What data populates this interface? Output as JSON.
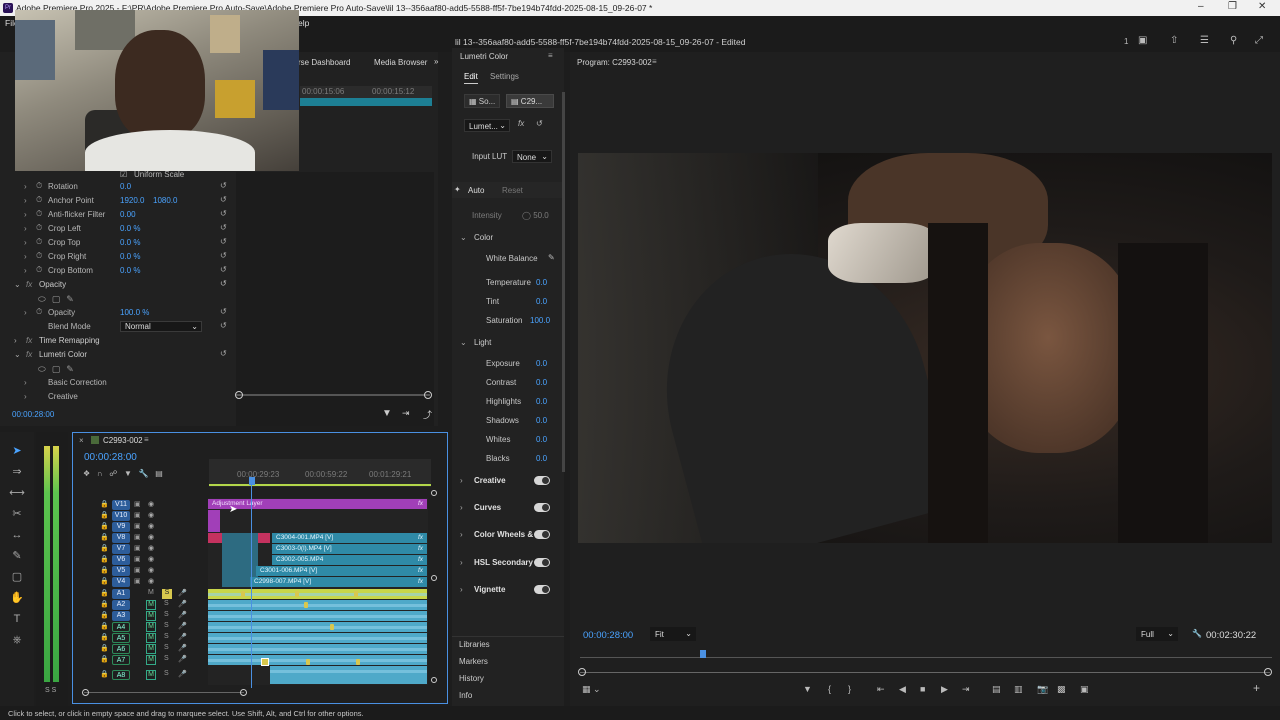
{
  "window": {
    "title": "Adobe Premiere Pro 2025 - F:\\PR\\Adobe Premiere Pro Auto-Save\\Adobe Premiere Pro Auto-Save\\lil 13--356aaf80-add5-5588-ff5f-7be194b74fdd-2025-08-15_09-26-07 *",
    "app_icon": "Pr"
  },
  "menubar": {
    "left": "File",
    "right": "elp"
  },
  "header": {
    "document": "lil 13--356aaf80-add5-5588-ff5f-7be194b74fdd-2025-08-15_09-26-07 - Edited",
    "count": "1"
  },
  "top_left_panel": {
    "tabs": [
      "rse Dashboard",
      "Media Browser"
    ],
    "ruler": [
      "00:00:15:06",
      "00:00:15:12"
    ]
  },
  "effect_controls": {
    "uniform_scale": "Uniform Scale",
    "rows": [
      {
        "label": "Rotation",
        "v1": "0.0"
      },
      {
        "label": "Anchor Point",
        "v1": "1920.0",
        "v2": "1080.0"
      },
      {
        "label": "Anti-flicker Filter",
        "v1": "0.00"
      },
      {
        "label": "Crop Left",
        "v1": "0.0 %"
      },
      {
        "label": "Crop Top",
        "v1": "0.0 %"
      },
      {
        "label": "Crop Right",
        "v1": "0.0 %"
      },
      {
        "label": "Crop Bottom",
        "v1": "0.0 %"
      }
    ],
    "opacity_section": "Opacity",
    "opacity_label": "Opacity",
    "opacity_value": "100.0 %",
    "blend_mode_label": "Blend Mode",
    "blend_mode_value": "Normal",
    "time_remapping": "Time Remapping",
    "lumetri_section": "Lumetri Color",
    "basic_correction": "Basic Correction",
    "creative": "Creative",
    "timecode": "00:00:28:00"
  },
  "lumetri_panel": {
    "title": "Lumetri Color",
    "tabs": [
      "Edit",
      "Settings"
    ],
    "source_btn": "So...",
    "clip_btn": "C29...",
    "effect_select": "Lumet...",
    "input_lut_label": "Input LUT",
    "input_lut_value": "None",
    "auto": "Auto",
    "reset": "Reset",
    "intensity_label": "Intensity",
    "intensity_value": "50.0",
    "color_section": "Color",
    "white_balance": "White Balance",
    "color_rows": [
      {
        "label": "Temperature",
        "value": "0.0"
      },
      {
        "label": "Tint",
        "value": "0.0"
      },
      {
        "label": "Saturation",
        "value": "100.0"
      }
    ],
    "light_section": "Light",
    "light_rows": [
      {
        "label": "Exposure",
        "value": "0.0"
      },
      {
        "label": "Contrast",
        "value": "0.0"
      },
      {
        "label": "Highlights",
        "value": "0.0"
      },
      {
        "label": "Shadows",
        "value": "0.0"
      },
      {
        "label": "Whites",
        "value": "0.0"
      },
      {
        "label": "Blacks",
        "value": "0.0"
      }
    ],
    "sections": [
      "Creative",
      "Curves",
      "Color Wheels & M",
      "HSL Secondary",
      "Vignette"
    ],
    "bottom_panels": [
      "Libraries",
      "Markers",
      "History",
      "Info"
    ]
  },
  "program_monitor": {
    "title": "Program: C2993-002",
    "timecode": "00:00:28:00",
    "fit": "Fit",
    "quality": "Full",
    "duration": "00:02:30:22"
  },
  "timeline": {
    "sequence": "C2993-002",
    "timecode": "00:00:28:00",
    "ruler": [
      "00:00:29:23",
      "00:00:59:22",
      "00:01:29:21"
    ],
    "video_tracks": [
      "V11",
      "V10",
      "V9",
      "V8",
      "V7",
      "V6",
      "V5",
      "V4"
    ],
    "audio_tracks": [
      "A1",
      "A2",
      "A3",
      "A4",
      "A5",
      "A6",
      "A7",
      "A8"
    ],
    "adjustment_layer": "Adjustment Layer",
    "clips": [
      {
        "label": "C3004-001.MP4 [V]"
      },
      {
        "label": "C3003-0(l).MP4 [V]"
      },
      {
        "label": "C3002-005.MP4"
      },
      {
        "label": "C3001-006.MP4 [V]"
      },
      {
        "label": "C2998-007.MP4 [V]"
      }
    ]
  },
  "meter": {
    "labels": "S S"
  },
  "status": "Click to select, or click in empty space and drag to marquee select. Use Shift, Alt, and Ctrl for other options."
}
